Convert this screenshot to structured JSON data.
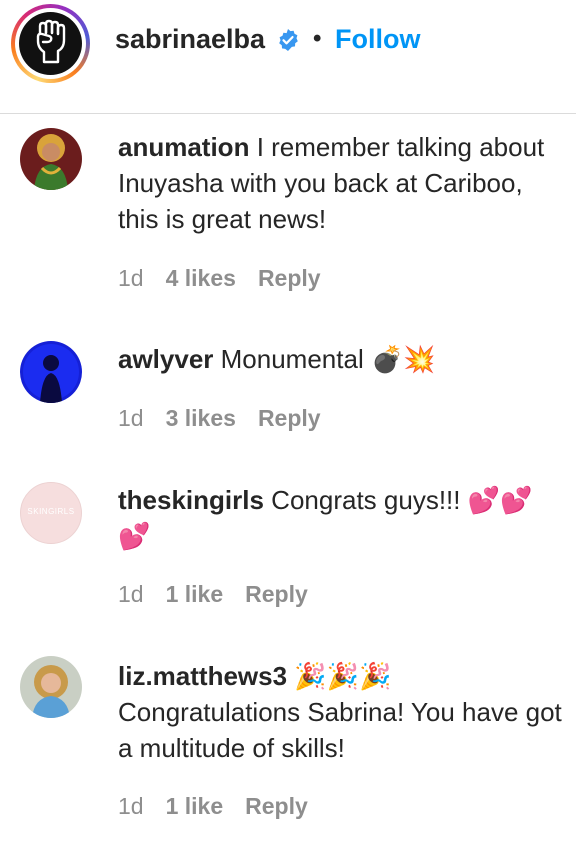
{
  "post": {
    "username": "sabrinaelba",
    "verified_icon": "verified-badge-icon",
    "separator": "•",
    "follow_label": "Follow",
    "accent_color": "#0095f6"
  },
  "comments": [
    {
      "username": "anumation",
      "text": "I remember talking about Inuyasha with you back at Cariboo, this is great news!",
      "age": "1d",
      "likes": "4 likes",
      "reply": "Reply"
    },
    {
      "username": "awlyver",
      "text": "Monumental 💣💥",
      "age": "1d",
      "likes": "3 likes",
      "reply": "Reply"
    },
    {
      "username": "theskingirls",
      "text": "Congrats guys!!! 💕💕💕",
      "age": "1d",
      "likes": "1 like",
      "reply": "Reply",
      "avatar_text": "SKINGIRLS"
    },
    {
      "username": "liz.matthews3",
      "text": "🎉🎉🎉 Congratulations Sabrina! You have got a multitude of skills!",
      "age": "1d",
      "likes": "1 like",
      "reply": "Reply"
    }
  ]
}
